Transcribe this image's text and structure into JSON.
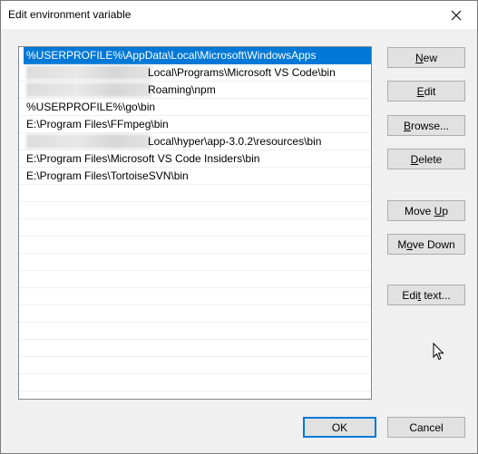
{
  "window": {
    "title": "Edit environment variable"
  },
  "list": {
    "items": [
      {
        "prefix_redacted": false,
        "text": "%USERPROFILE%\\AppData\\Local\\Microsoft\\WindowsApps",
        "selected": true
      },
      {
        "prefix_redacted": true,
        "text": "Local\\Programs\\Microsoft VS Code\\bin",
        "selected": false
      },
      {
        "prefix_redacted": true,
        "text": "Roaming\\npm",
        "selected": false
      },
      {
        "prefix_redacted": false,
        "text": "%USERPROFILE%\\go\\bin",
        "selected": false
      },
      {
        "prefix_redacted": false,
        "text": "E:\\Program Files\\FFmpeg\\bin",
        "selected": false
      },
      {
        "prefix_redacted": true,
        "text": "Local\\hyper\\app-3.0.2\\resources\\bin",
        "selected": false
      },
      {
        "prefix_redacted": false,
        "text": "E:\\Program Files\\Microsoft VS Code Insiders\\bin",
        "selected": false
      },
      {
        "prefix_redacted": false,
        "text": "E:\\Program Files\\TortoiseSVN\\bin",
        "selected": false
      }
    ]
  },
  "buttons": {
    "new": {
      "label": "New",
      "accel": "N"
    },
    "edit": {
      "label": "Edit",
      "accel": "E"
    },
    "browse": {
      "label": "Browse...",
      "accel": "B"
    },
    "delete": {
      "label": "Delete",
      "accel": "D"
    },
    "move_up": {
      "label": "Move Up",
      "accel": "U"
    },
    "move_down": {
      "label": "Move Down",
      "accel": "o"
    },
    "edit_text": {
      "label": "Edit text...",
      "accel": "t"
    },
    "ok": {
      "label": "OK"
    },
    "cancel": {
      "label": "Cancel"
    }
  },
  "colors": {
    "selection": "#0078d7",
    "window_bg": "#f0f0f0",
    "list_bg": "#ffffff"
  },
  "icons": {
    "close": "close-icon",
    "cursor": "mouse-pointer-icon"
  }
}
